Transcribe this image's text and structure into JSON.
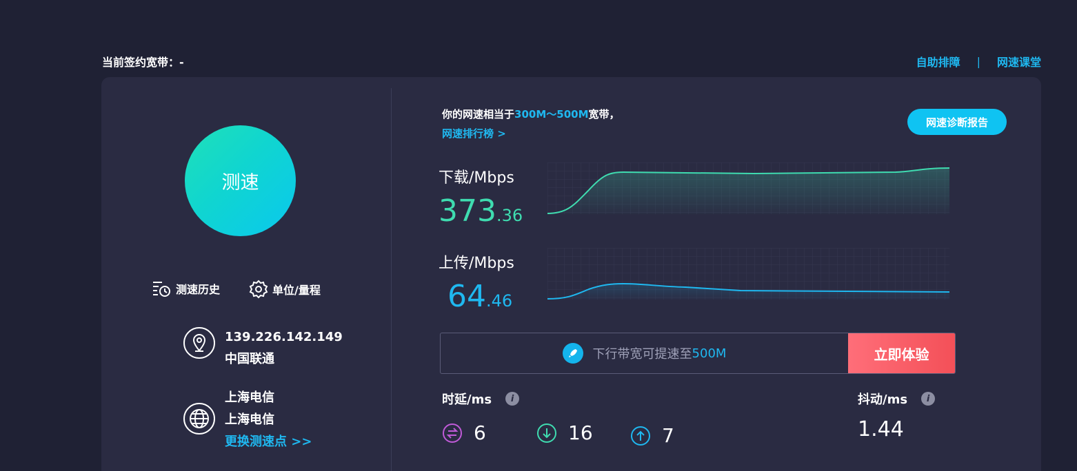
{
  "header": {
    "bandwidth_label": "当前签约宽带：-",
    "link_troubleshoot": "自助排障",
    "separator": "|",
    "link_class": "网速课堂"
  },
  "left": {
    "speed_button": "测速",
    "history_label": "测速历史",
    "unit_label": "单位/量程",
    "ip": "139.226.142.149",
    "isp": "中国联通",
    "node_line1": "上海电信",
    "node_line2": "上海电信",
    "change_node": "更换测速点 >>"
  },
  "right": {
    "rate_prefix": "你的网速相当于",
    "rate_range": "300M～500M",
    "rate_suffix": "宽带，",
    "rank_link": "网速排行榜 >",
    "report_button": "网速诊断报告",
    "download_label": "下载/Mbps",
    "download_int": "373",
    "download_dec": ".36",
    "upload_label": "上传/Mbps",
    "upload_int": "64",
    "upload_dec": ".46",
    "promo_text": "下行带宽可提速至",
    "promo_highlight": "500M",
    "promo_button": "立即体验",
    "latency_label": "时延/ms",
    "latency_info": "i",
    "latency_values": [
      "6",
      "16",
      "7"
    ],
    "jitter_label": "抖动/ms",
    "jitter_info": "i",
    "jitter_value": "1.44"
  },
  "colors": {
    "background": "#1f2134",
    "panel": "#2a2b42",
    "accent_blue": "#1fb8f0",
    "download_green": "#3fdcb0",
    "promo_red": "#f35058",
    "latency_purple": "#c05ad8",
    "latency_teal": "#3fdcb0",
    "latency_blue": "#1fb8f0"
  },
  "icons": {
    "history": "history-list-icon",
    "unit": "gear-icon",
    "ip": "location-pin-icon",
    "node": "globe-icon",
    "promo": "rocket-icon",
    "latency_1": "swap-icon",
    "latency_2": "arrow-down-circle-icon",
    "latency_3": "arrow-up-circle-icon"
  }
}
